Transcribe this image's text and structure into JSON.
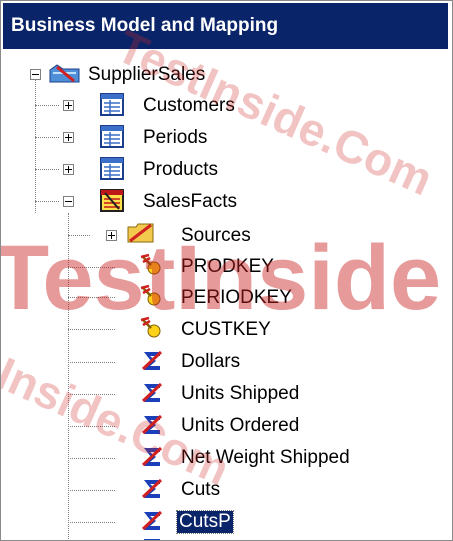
{
  "panel": {
    "title": "Business Model and Mapping"
  },
  "tree": {
    "root": {
      "label": "SupplierSales",
      "icon": "business-model-icon",
      "expanded": true
    },
    "tables": [
      {
        "label": "Customers",
        "icon": "logical-table-icon",
        "expanded": false
      },
      {
        "label": "Periods",
        "icon": "logical-table-icon",
        "expanded": false
      },
      {
        "label": "Products",
        "icon": "logical-table-icon",
        "expanded": false
      },
      {
        "label": "SalesFacts",
        "icon": "fact-table-icon",
        "expanded": true
      }
    ],
    "sources": {
      "label": "Sources",
      "icon": "sources-folder-icon",
      "expanded": false
    },
    "keys": [
      {
        "label": "PRODKEY",
        "icon": "key-column-icon"
      },
      {
        "label": "PERIODKEY",
        "icon": "key-column-icon"
      },
      {
        "label": "CUSTKEY",
        "icon": "key-column-icon"
      }
    ],
    "measures": [
      {
        "label": "Dollars",
        "icon": "measure-column-icon"
      },
      {
        "label": "Units Shipped",
        "icon": "measure-column-icon"
      },
      {
        "label": "Units Ordered",
        "icon": "measure-column-icon"
      },
      {
        "label": "Net Weight Shipped",
        "icon": "measure-column-icon"
      },
      {
        "label": "Cuts",
        "icon": "measure-column-icon"
      },
      {
        "label": "CutsP",
        "icon": "measure-column-icon",
        "selected": true
      }
    ]
  },
  "watermark": {
    "text_1": "TestInside.Com",
    "text_2": "TestInside",
    "text_3": "Inside.Com",
    "color": "#d22828"
  }
}
